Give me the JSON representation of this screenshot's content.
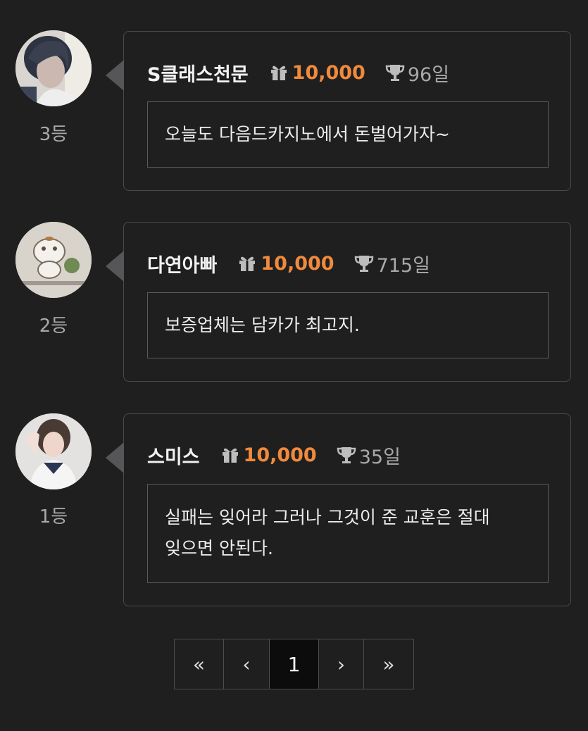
{
  "entries": [
    {
      "rank": "3등",
      "nickname": "S클래스천문",
      "points": "10,000",
      "days": "96일",
      "message": "오늘도 다음드카지노에서 돈벌어가자~",
      "avatar": "avatar-girl-dark-hair"
    },
    {
      "rank": "2등",
      "nickname": "다연아빠",
      "points": "10,000",
      "days": "715일",
      "message": "보증업체는 담카가 최고지.",
      "avatar": "avatar-hamster-drawing"
    },
    {
      "rank": "1등",
      "nickname": "스미스",
      "points": "10,000",
      "days": "35일",
      "message_line1": "실패는 잊어라 그러나 그것이 준 교훈은 절대",
      "message_line2": "잊으면 안된다.",
      "avatar": "avatar-girl-sailor-uniform"
    }
  ],
  "pagination": {
    "first": "«",
    "prev": "‹",
    "current": "1",
    "next": "›",
    "last": "»"
  },
  "icons": {
    "points": "gift-icon",
    "days": "trophy-icon"
  },
  "colors": {
    "accent": "#f08a3c",
    "background": "#1f1f20",
    "border": "#4a4a4c"
  }
}
